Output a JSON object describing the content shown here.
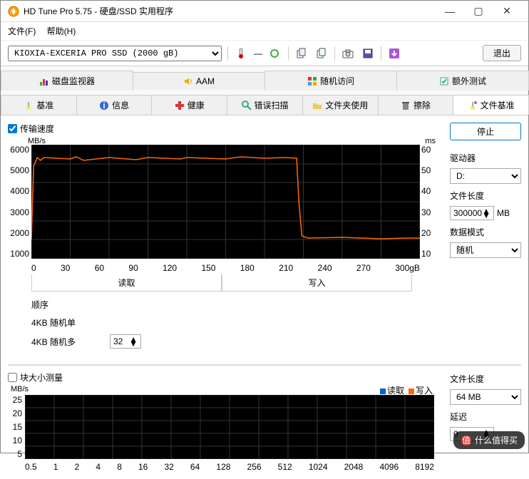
{
  "window": {
    "title": "HD Tune Pro 5.75 - 硬盘/SSD 实用程序"
  },
  "menu": {
    "file": "文件(F)",
    "help": "帮助(H)"
  },
  "toolbar": {
    "drive_selected": "KIOXIA-EXCERIA PRO SSD (2000 gB)",
    "temp_dash": "—",
    "exit": "退出"
  },
  "tabs_top": {
    "disk_monitor": "磁盘监视器",
    "aam": "AAM",
    "random_access": "随机访问",
    "extra_tests": "额外测试"
  },
  "tabs_bottom": {
    "benchmark": "基准",
    "info": "信息",
    "health": "健康",
    "error_scan": "错误扫描",
    "folder_usage": "文件夹使用",
    "erase": "擦除",
    "file_benchmark": "文件基准"
  },
  "section1": {
    "transfer_speed": "传输速度",
    "y_label": "MB/s",
    "y_right_label": "ms",
    "y_ticks": [
      "6000",
      "5000",
      "4000",
      "3000",
      "2000",
      "1000"
    ],
    "y_right_ticks": [
      "60",
      "50",
      "40",
      "30",
      "20",
      "10"
    ],
    "x_ticks": [
      "0",
      "30",
      "60",
      "90",
      "120",
      "150",
      "180",
      "210",
      "240",
      "270",
      "300gB"
    ],
    "read": "读取",
    "write": "写入",
    "sequential": "顺序",
    "kb4_single": "4KB 随机单",
    "kb4_multi": "4KB 随机多",
    "multi_value": "32"
  },
  "right1": {
    "stop": "停止",
    "drive": "驱动器",
    "drive_val": "D:",
    "file_len": "文件长度",
    "file_len_val": "300000",
    "file_len_unit": "MB",
    "data_mode": "数据模式",
    "data_mode_val": "随机"
  },
  "section2": {
    "block_measure": "块大小测量",
    "y_label": "MB/s",
    "y_ticks": [
      "25",
      "20",
      "15",
      "10",
      "5"
    ],
    "x_ticks": [
      "0.5",
      "1",
      "2",
      "4",
      "8",
      "16",
      "32",
      "64",
      "128",
      "256",
      "512",
      "1024",
      "2048",
      "4096",
      "8192"
    ],
    "legend_read": "读取",
    "legend_write": "写入"
  },
  "right2": {
    "file_len": "文件长度",
    "file_len_val": "64 MB",
    "delay": "延迟",
    "delay_val": "0"
  },
  "watermark": "什么值得买",
  "chart_data": {
    "type": "line",
    "title": "传输速度",
    "xlabel": "gB",
    "ylabel": "MB/s",
    "x_range": [
      0,
      300
    ],
    "y_range": [
      0,
      6000
    ],
    "y2_range_ms": [
      0,
      60
    ],
    "series": [
      {
        "name": "写入",
        "x": [
          0,
          2,
          5,
          10,
          30,
          60,
          90,
          120,
          150,
          180,
          205,
          210,
          215,
          220,
          240,
          270,
          300
        ],
        "y": [
          1000,
          4800,
          5300,
          5350,
          5300,
          5350,
          5300,
          5350,
          5300,
          5350,
          5350,
          3000,
          1200,
          1100,
          1100,
          1050,
          1100
        ]
      }
    ]
  }
}
